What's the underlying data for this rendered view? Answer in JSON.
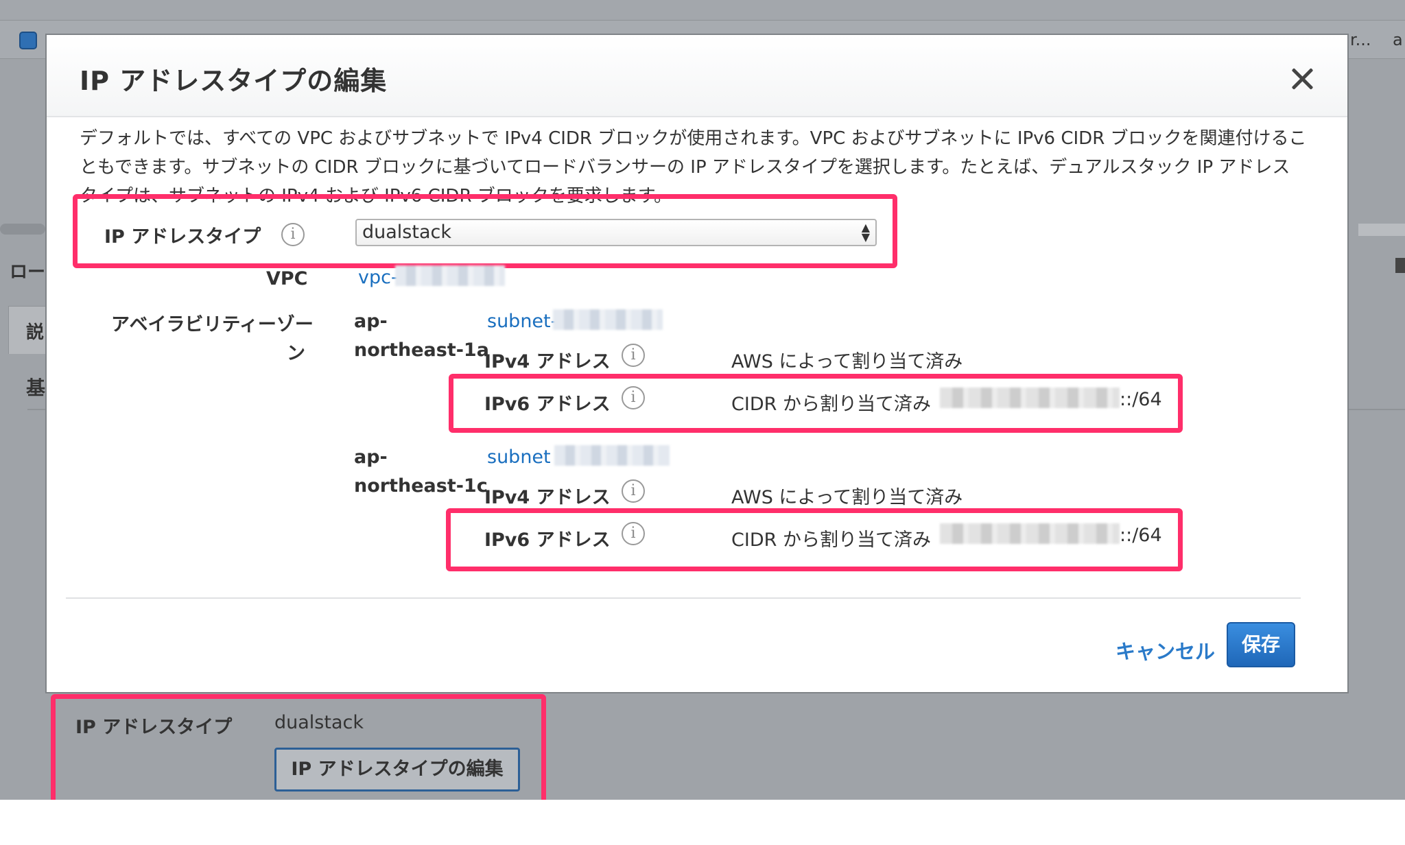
{
  "background": {
    "ellipsis": "r...",
    "partial_a": "a",
    "section_label": "ロー",
    "tab_label": "説",
    "heading_partial": "基",
    "field_label": "IP アドレスタイプ",
    "field_value": "dualstack",
    "edit_button_label": "IP アドレスタイプの編集"
  },
  "modal": {
    "title": "IP アドレスタイプの編集",
    "description": "デフォルトでは、すべての VPC およびサブネットで IPv4 CIDR ブロックが使用されます。VPC およびサブネットに IPv6 CIDR ブロックを関連付けることもできます。サブネットの CIDR ブロックに基づいてロードバランサーの IP アドレスタイプを選択します。たとえば、デュアルスタック IP アドレスタイプは、サブネットの IPv4 および IPv6 CIDR ブロックを要求します。",
    "ip_type_label": "IP アドレスタイプ",
    "ip_type_value": "dualstack",
    "vpc_label": "VPC",
    "vpc_value": "vpc-",
    "az_label_line1": "アベイラビリティーゾー",
    "az_label_line2": "ン",
    "zones": [
      {
        "name_line1": "ap-",
        "name_line2": "northeast-1a",
        "subnet": "subnet-",
        "ipv4_label": "IPv4 アドレス",
        "ipv4_value": "AWS によって割り当て済み",
        "ipv6_label": "IPv6 アドレス",
        "ipv6_value": "CIDR から割り当て済み",
        "ipv6_suffix": "::/64"
      },
      {
        "name_line1": "ap-",
        "name_line2": "northeast-1c",
        "subnet": "subnet",
        "ipv4_label": "IPv4 アドレス",
        "ipv4_value": "AWS によって割り当て済み",
        "ipv6_label": "IPv6 アドレス",
        "ipv6_value": "CIDR から割り当て済み",
        "ipv6_suffix": "::/64"
      }
    ],
    "info_glyph": "i",
    "select_arrows": "▲▼",
    "close_glyph": "close-icon",
    "cancel_label": "キャンセル",
    "save_label": "保存"
  },
  "colors": {
    "highlight": "#ff2e6a",
    "link": "#1a6fbf",
    "primary_button": "#2a7ac9"
  }
}
